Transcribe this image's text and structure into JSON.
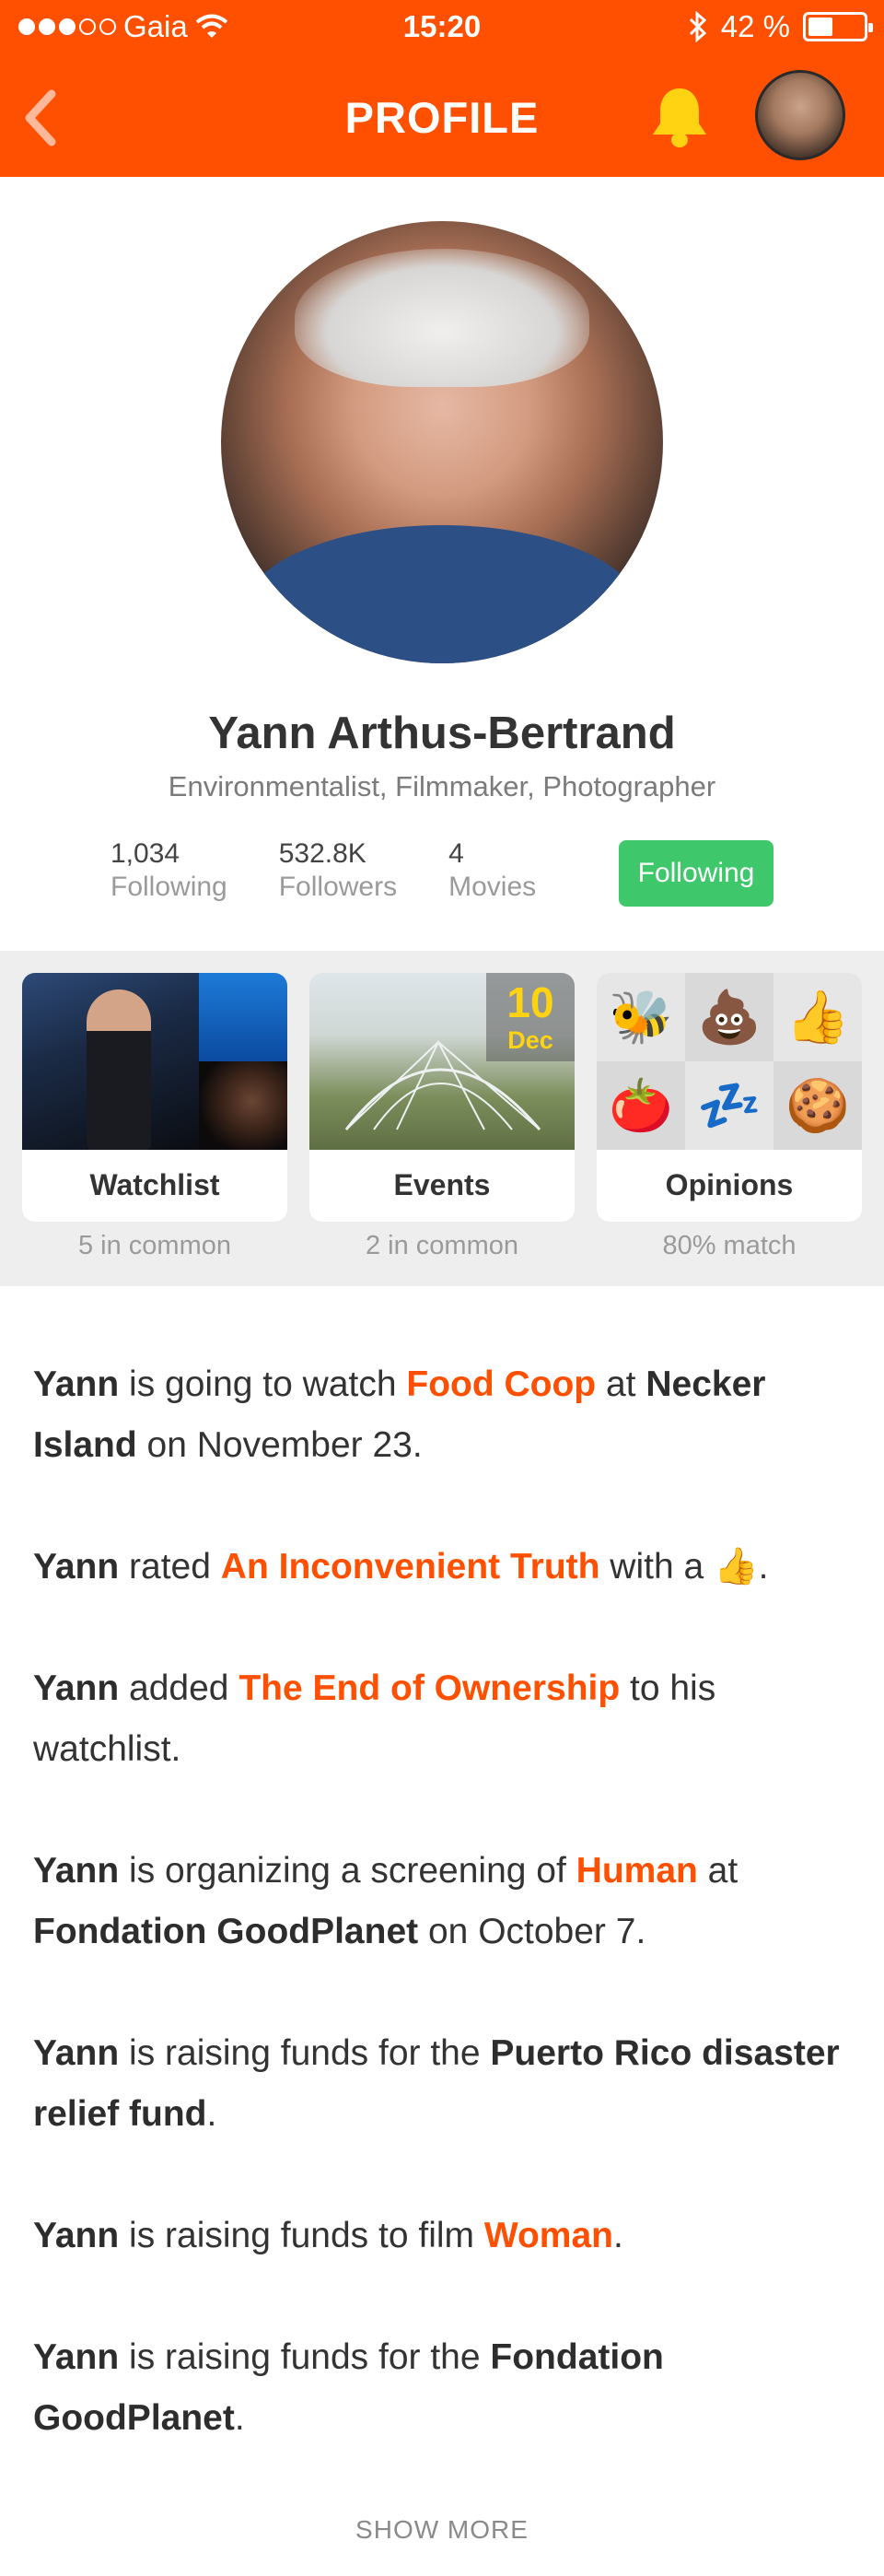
{
  "status_bar": {
    "carrier": "Gaia",
    "time": "15:20",
    "battery": "42 %"
  },
  "header": {
    "title": "PROFILE",
    "accent_color": "#fe5000"
  },
  "profile": {
    "name": "Yann Arthus-Bertrand",
    "subtitle": "Environmentalist, Filmmaker, Photographer",
    "stats": [
      {
        "value": "1,034",
        "label": "Following"
      },
      {
        "value": "532.8K",
        "label": "Followers"
      },
      {
        "value": "4",
        "label": "Movies"
      }
    ],
    "follow_button": "Following",
    "follow_button_color": "#3fc86b"
  },
  "cards": [
    {
      "label": "Watchlist",
      "common": "5 in common"
    },
    {
      "label": "Events",
      "common": "2 in common",
      "date_day": "10",
      "date_month": "Dec"
    },
    {
      "label": "Opinions",
      "common": "80% match",
      "emojis": [
        "🐝",
        "💩",
        "👍",
        "🍅",
        "💤",
        "🍪"
      ]
    }
  ],
  "feed": {
    "items": [
      {
        "subject": "Yann",
        "t1": " is going to watch ",
        "link": "Food Coop",
        "t2": " at ",
        "bold": "Necker Island",
        "t3": " on November 23."
      },
      {
        "subject": "Yann",
        "t1": " rated ",
        "link": "An Inconvenient Truth",
        "t2": " with a ",
        "emoji": "👍",
        "t3": "."
      },
      {
        "subject": "Yann",
        "t1": " added ",
        "link": "The End of Ownership",
        "t2": " to his watchlist."
      },
      {
        "subject": "Yann",
        "t1": " is organizing a screening of ",
        "link": "Human",
        "t2": " at ",
        "bold": "Fondation GoodPlanet",
        "t3": " on October 7."
      },
      {
        "subject": "Yann",
        "t1": " is raising funds for the ",
        "bold": "Puerto Rico disaster relief fund",
        "t2": "."
      },
      {
        "subject": "Yann",
        "t1": " is raising funds to film ",
        "link": "Woman",
        "t2": "."
      },
      {
        "subject": "Yann",
        "t1": " is raising funds for the ",
        "bold": "Fondation GoodPlanet",
        "t2": "."
      }
    ],
    "show_more": "SHOW MORE"
  }
}
